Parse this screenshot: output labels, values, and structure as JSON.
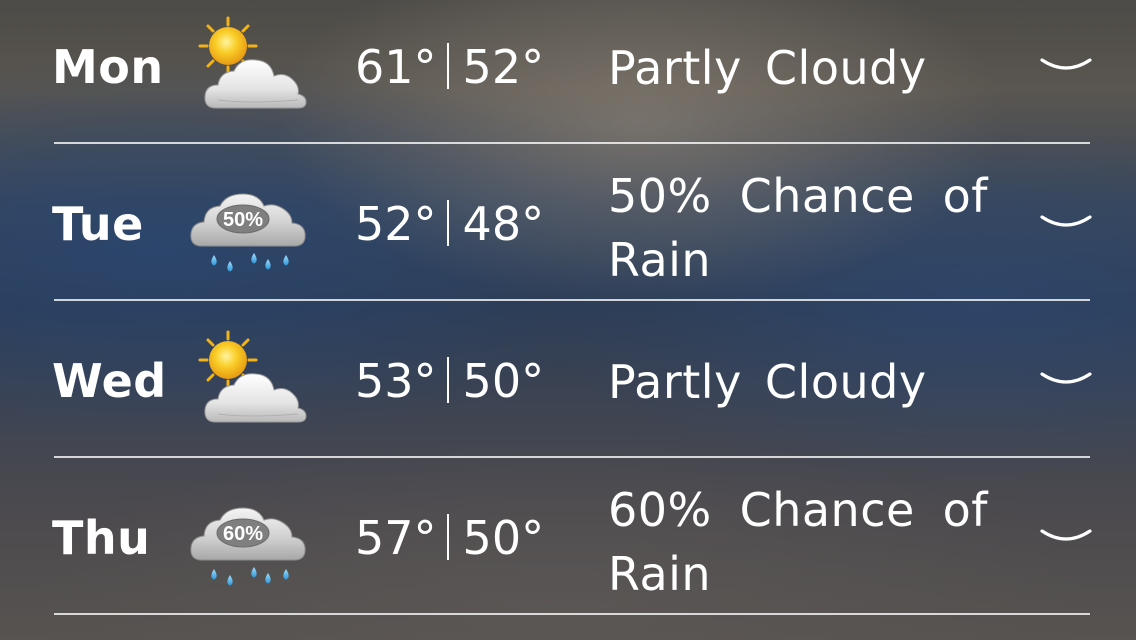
{
  "forecast": {
    "days": [
      {
        "day": "Mon",
        "high": "61°",
        "low": "52°",
        "condition": "Partly Cloudy",
        "icon": "partly-cloudy-icon",
        "precip_label": ""
      },
      {
        "day": "Tue",
        "high": "52°",
        "low": "48°",
        "condition": "50% Chance of Rain",
        "icon": "rain-cloud-icon",
        "precip_label": "50%"
      },
      {
        "day": "Wed",
        "high": "53°",
        "low": "50°",
        "condition": "Partly Cloudy",
        "icon": "partly-cloudy-icon",
        "precip_label": ""
      },
      {
        "day": "Thu",
        "high": "57°",
        "low": "50°",
        "condition": "60% Chance of Rain",
        "icon": "rain-cloud-icon",
        "precip_label": "60%"
      }
    ],
    "separator": "|",
    "expand_icon": "chevron-down-icon"
  },
  "colors": {
    "text": "#ffffff",
    "sun": "#f7c21a",
    "cloud": "#e6e6e6",
    "rain_cloud": "#d0d0d0",
    "raindrop": "#4fb4ea"
  }
}
